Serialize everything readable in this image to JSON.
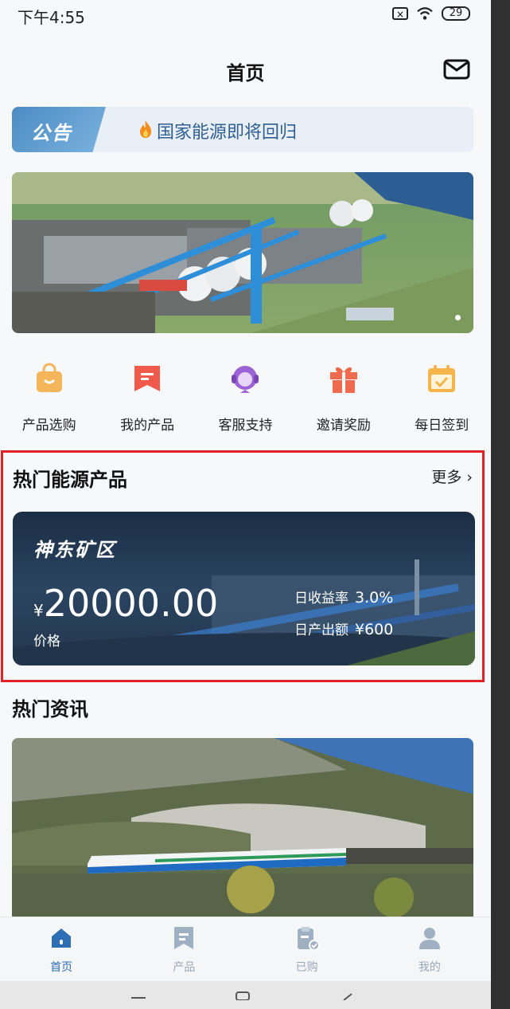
{
  "status_bar": {
    "time": "下午4:55",
    "sim": "×",
    "battery": "29"
  },
  "header": {
    "title": "首页"
  },
  "notice": {
    "label": "公告",
    "text": "国家能源即将回归"
  },
  "quick_actions": [
    {
      "label": "产品选购",
      "icon": "shopping-bag-icon",
      "color": "#f5b55a"
    },
    {
      "label": "我的产品",
      "icon": "bookmark-icon",
      "color": "#ef5a4a"
    },
    {
      "label": "客服支持",
      "icon": "headset-icon",
      "color": "#9b63d6"
    },
    {
      "label": "邀请奖励",
      "icon": "gift-icon",
      "color": "#ef6a4e"
    },
    {
      "label": "每日签到",
      "icon": "calendar-check-icon",
      "color": "#f6b44b"
    }
  ],
  "hot_products": {
    "title": "热门能源产品",
    "more": "更多",
    "card": {
      "name": "神东矿区",
      "currency": "¥",
      "price": "20000.00",
      "price_label": "价格",
      "rate_label": "日收益率",
      "rate_value": "3.0%",
      "output_label": "日产出额",
      "output_value": "¥600"
    }
  },
  "news": {
    "title": "热门资讯"
  },
  "tabbar": [
    {
      "label": "首页",
      "icon": "home-icon",
      "active": true
    },
    {
      "label": "产品",
      "icon": "bookmark-icon",
      "active": false
    },
    {
      "label": "已购",
      "icon": "clipboard-check-icon",
      "active": false
    },
    {
      "label": "我的",
      "icon": "user-icon",
      "active": false
    }
  ],
  "colors": {
    "accent": "#2e6fb3",
    "highlight_border": "#e32126"
  }
}
